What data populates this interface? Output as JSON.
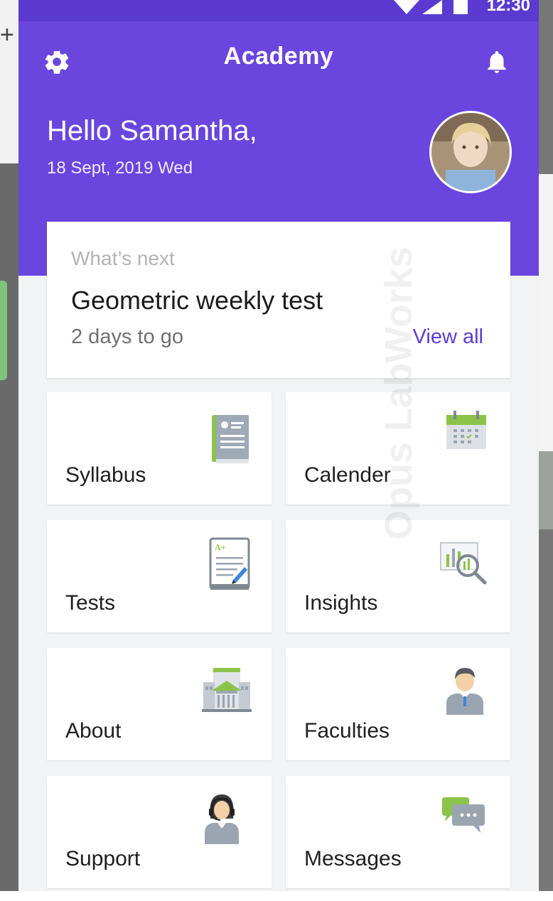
{
  "status_bar": {
    "time": "12:30"
  },
  "header": {
    "title": "Academy",
    "greeting": "Hello Samantha,",
    "date": "18 Sept, 2019  Wed"
  },
  "next_card": {
    "label": "What’s next",
    "title": "Geometric weekly test",
    "subtitle": "2 days to go",
    "link": "View all"
  },
  "tiles": [
    {
      "label": "Syllabus",
      "icon": "book-icon"
    },
    {
      "label": "Calender",
      "icon": "calendar-icon"
    },
    {
      "label": "Tests",
      "icon": "test-sheet-icon"
    },
    {
      "label": "Insights",
      "icon": "insights-magnifier-icon"
    },
    {
      "label": "About",
      "icon": "building-icon"
    },
    {
      "label": "Faculties",
      "icon": "teacher-icon"
    },
    {
      "label": "Support",
      "icon": "support-agent-icon"
    },
    {
      "label": "Messages",
      "icon": "chat-bubbles-icon"
    }
  ],
  "watermark": "Opus LabWorks",
  "colors": {
    "header": "#6a45de",
    "status_bar": "#5a3ad0",
    "accent": "#5b3bd6",
    "green": "#8bc34a"
  }
}
